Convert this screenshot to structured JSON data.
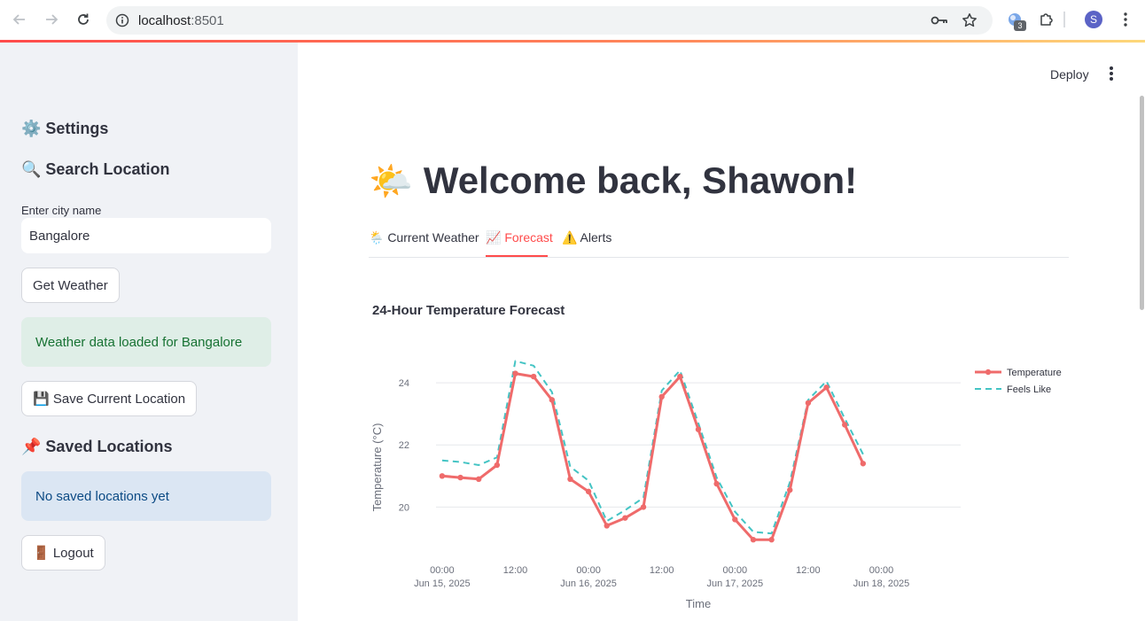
{
  "browser": {
    "url_host": "localhost",
    "url_port": ":8501",
    "extension_badge": "3",
    "profile_initial": "S"
  },
  "sidebar": {
    "settings_heading": "⚙️ Settings",
    "search_heading": "🔍 Search Location",
    "city_label": "Enter city name",
    "city_value": "Bangalore",
    "get_weather_button": "Get Weather",
    "success_message": "Weather data loaded for Bangalore",
    "save_location_button": "💾 Save Current Location",
    "saved_heading": "📌 Saved Locations",
    "saved_empty_message": "No saved locations yet",
    "logout_button": "🚪 Logout"
  },
  "header": {
    "deploy_label": "Deploy"
  },
  "main": {
    "title_emoji": "🌤️",
    "title": "Welcome back, Shawon!",
    "tabs": [
      {
        "label": "🌦️ Current Weather"
      },
      {
        "label": "📈 Forecast"
      },
      {
        "label": "⚠️ Alerts"
      }
    ],
    "active_tab": 1
  },
  "colors": {
    "accent": "#ff4b4b",
    "temperature_line": "#ef6b6b",
    "feels_like_line": "#44c4c4"
  },
  "chart_data": {
    "type": "line",
    "title": "24-Hour Temperature Forecast",
    "xlabel": "Time",
    "ylabel": "Temperature (°C)",
    "ylim": [
      18.5,
      25.2
    ],
    "xlim": [
      -1,
      85
    ],
    "x_unit": "hours from Jun 15, 2025 00:00",
    "yticks": [
      20,
      22,
      24
    ],
    "xticks": [
      {
        "x": 0,
        "line1": "00:00",
        "line2": "Jun 15, 2025"
      },
      {
        "x": 12,
        "line1": "12:00",
        "line2": ""
      },
      {
        "x": 24,
        "line1": "00:00",
        "line2": "Jun 16, 2025"
      },
      {
        "x": 36,
        "line1": "12:00",
        "line2": ""
      },
      {
        "x": 48,
        "line1": "00:00",
        "line2": "Jun 17, 2025"
      },
      {
        "x": 60,
        "line1": "12:00",
        "line2": ""
      },
      {
        "x": 72,
        "line1": "00:00",
        "line2": "Jun 18, 2025"
      }
    ],
    "grid": true,
    "legend_position": "top-right",
    "x": [
      0,
      3,
      6,
      9,
      12,
      15,
      18,
      21,
      24,
      27,
      30,
      33,
      36,
      39,
      42,
      45,
      48,
      51,
      54,
      57,
      60,
      63,
      66,
      69
    ],
    "series": [
      {
        "name": "Temperature",
        "style": "solid-markers",
        "values": [
          21.0,
          20.95,
          20.9,
          21.35,
          24.3,
          24.2,
          23.45,
          20.9,
          20.5,
          19.4,
          19.65,
          20.0,
          23.55,
          24.2,
          22.5,
          20.75,
          19.6,
          18.95,
          18.95,
          20.55,
          23.35,
          23.85,
          22.65,
          21.4
        ]
      },
      {
        "name": "Feels Like",
        "style": "dashed",
        "values": [
          21.5,
          21.45,
          21.35,
          21.6,
          24.7,
          24.55,
          23.7,
          21.3,
          20.85,
          19.55,
          19.9,
          20.3,
          23.75,
          24.4,
          22.7,
          20.95,
          19.85,
          19.2,
          19.15,
          20.8,
          23.45,
          24.05,
          22.85,
          21.7
        ]
      }
    ]
  }
}
